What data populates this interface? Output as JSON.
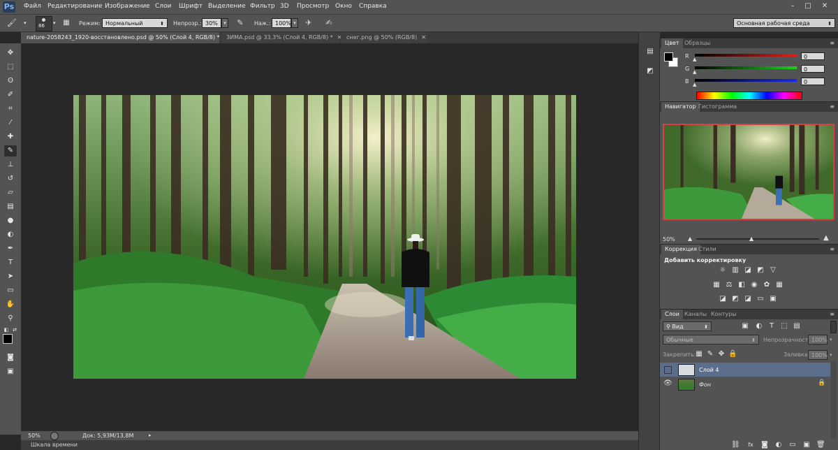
{
  "menubar": {
    "logo": "Ps",
    "items": [
      "Файл",
      "Редактирование",
      "Изображение",
      "Слои",
      "Шрифт",
      "Выделение",
      "Фильтр",
      "3D",
      "Просмотр",
      "Окно",
      "Справка"
    ],
    "window_controls": [
      "–",
      "□",
      "✕"
    ]
  },
  "options": {
    "brush_size": "86",
    "mode_label": "Режим:",
    "mode_value": "Нормальный",
    "opacity_label": "Непрозр.:",
    "opacity_value": "30%",
    "pressure_label": "Наж.:",
    "pressure_value": "100%",
    "workspace": "Основная рабочая среда"
  },
  "tabs": [
    {
      "title": "nature-2058243_1920-восстановлено.psd @ 50% (Слой 4, RGB/8) *",
      "active": true
    },
    {
      "title": "ЗИМА.psd @ 33,3% (Слой 4, RGB/8) *",
      "active": false
    },
    {
      "title": "снег.png @ 50% (RGB/8)",
      "active": false
    }
  ],
  "status": {
    "zoom": "50%",
    "doc_size": "Док: 5,93M/13,8M"
  },
  "timeline": {
    "label": "Шкала времени"
  },
  "color_panel": {
    "tabs": [
      "Цвет",
      "Образцы"
    ],
    "channels": [
      {
        "name": "R",
        "value": "0",
        "color": "#e0201a"
      },
      {
        "name": "G",
        "value": "0",
        "color": "#1fcf1f"
      },
      {
        "name": "B",
        "value": "0",
        "color": "#1a2ae6"
      }
    ]
  },
  "navigator_panel": {
    "tabs": [
      "Навигатор",
      "Гистограмма"
    ],
    "zoom": "50%"
  },
  "adjustments_panel": {
    "tabs": [
      "Коррекция",
      "Стили"
    ],
    "title": "Добавить корректировку"
  },
  "layers_panel": {
    "tabs": [
      "Слои",
      "Каналы",
      "Контуры"
    ],
    "filter": "Вид",
    "blend_mode": "Обычные",
    "opacity_label": "Непрозрачность:",
    "opacity_value": "100%",
    "lock_label": "Закрепить:",
    "fill_label": "Заливка:",
    "fill_value": "100%",
    "layers": [
      {
        "name": "Слой 4",
        "visible": false,
        "selected": true
      },
      {
        "name": "Фон",
        "visible": true,
        "selected": false,
        "locked": true
      }
    ]
  },
  "colors": {
    "accent_selected": "#5b6f8c",
    "nav_frame": "#d64040"
  }
}
